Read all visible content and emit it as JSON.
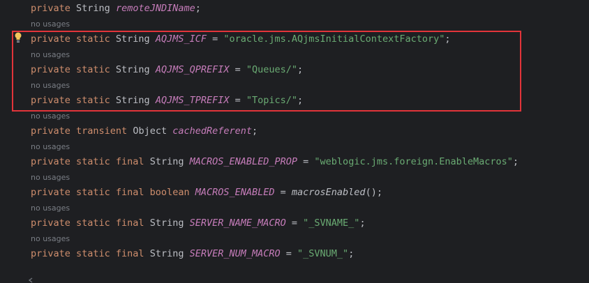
{
  "editor": {
    "hint_text": "no usages",
    "colors": {
      "background": "#1e1f22",
      "keyword": "#cf8e6d",
      "field": "#c77dbb",
      "string": "#6aab73",
      "text": "#bcbec4",
      "hint": "#7a7e85",
      "highlight": "#e2343a"
    },
    "icons": [
      "intention-bulb-icon",
      "fold-marker-icon"
    ]
  },
  "lines": [
    {
      "kw": "private ",
      "type": "String ",
      "field": "remoteJNDIName",
      "tail": ";"
    },
    {
      "kw": "private static ",
      "type": "String ",
      "field": "AQJMS_ICF",
      "eq": " = ",
      "value": "\"oracle.jms.AQjmsInitialContextFactory\"",
      "tail": ";"
    },
    {
      "kw": "private static ",
      "type": "String ",
      "field": "AQJMS_QPREFIX",
      "eq": " = ",
      "value": "\"Queues/\"",
      "tail": ";"
    },
    {
      "kw": "private static ",
      "type": "String ",
      "field": "AQJMS_TPREFIX",
      "eq": " = ",
      "value": "\"Topics/\"",
      "tail": ";"
    },
    {
      "kw": "private transient ",
      "type": "Object ",
      "field": "cachedReferent",
      "tail": ";"
    },
    {
      "kw": "private static final ",
      "type": "String ",
      "field": "MACROS_ENABLED_PROP",
      "eq": " = ",
      "value": "\"weblogic.jms.foreign.EnableMacros\"",
      "tail": ";"
    },
    {
      "kw": "private static final boolean ",
      "type": "",
      "field": "MACROS_ENABLED",
      "eq": " = ",
      "call": "macrosEnabled",
      "tail": "();"
    },
    {
      "kw": "private static final ",
      "type": "String ",
      "field": "SERVER_NAME_MACRO",
      "eq": " = ",
      "value": "\"_SVNAME_\"",
      "tail": ";"
    },
    {
      "kw": "private static final ",
      "type": "String ",
      "field": "SERVER_NUM_MACRO",
      "eq": " = ",
      "value": "\"_SVNUM_\"",
      "tail": ";"
    }
  ]
}
